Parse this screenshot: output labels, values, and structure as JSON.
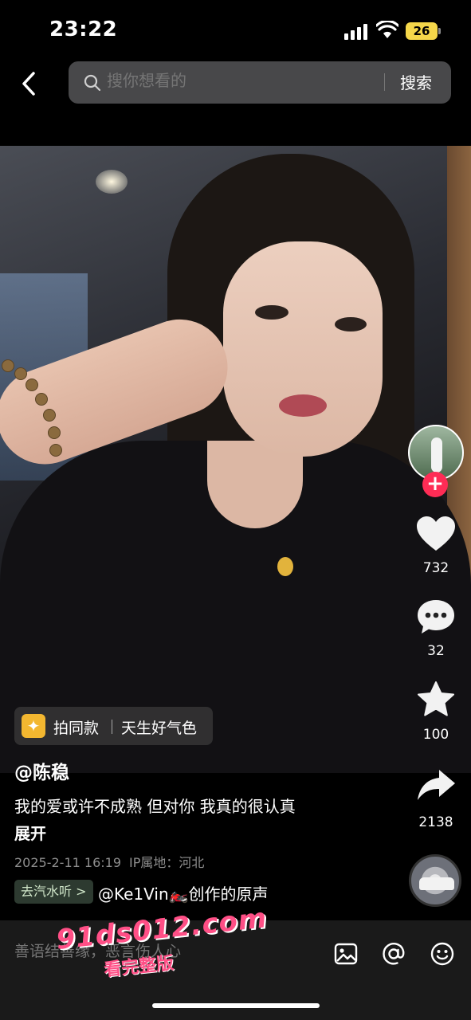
{
  "status_bar": {
    "time": "23:22",
    "battery": "26"
  },
  "search": {
    "placeholder": "搜你想看的",
    "button_label": "搜索"
  },
  "actions": {
    "likes": "732",
    "comments": "32",
    "favorites": "100",
    "shares": "2138"
  },
  "same_style": {
    "label": "拍同款",
    "name": "天生好气色"
  },
  "post": {
    "username": "@陈稳",
    "caption": "我的爱或许不成熟 但对你 我真的很认真",
    "expand_label": "展开",
    "date": "2025-2-11 16:19",
    "ip_location": "IP属地：河北"
  },
  "sound": {
    "listen_label": "去汽水听 >",
    "credit": "@Ke1Vin🏍️创作的原声"
  },
  "comment_bar": {
    "placeholder": "善语结善缘，恶言伤人心"
  },
  "watermark": {
    "line1": "91ds012.com",
    "line2": "看完整版"
  },
  "icons": {
    "back": "chevron-left-icon",
    "search": "search-icon",
    "like": "heart-icon",
    "comment": "comment-bubble-icon",
    "favorite": "star-icon",
    "share": "share-arrow-icon",
    "image": "image-icon",
    "mention": "at-icon",
    "emoji": "emoji-icon"
  },
  "colors": {
    "accent": "#fe2c55",
    "battery": "#f5d74a",
    "sparkle": "#f3b730"
  }
}
